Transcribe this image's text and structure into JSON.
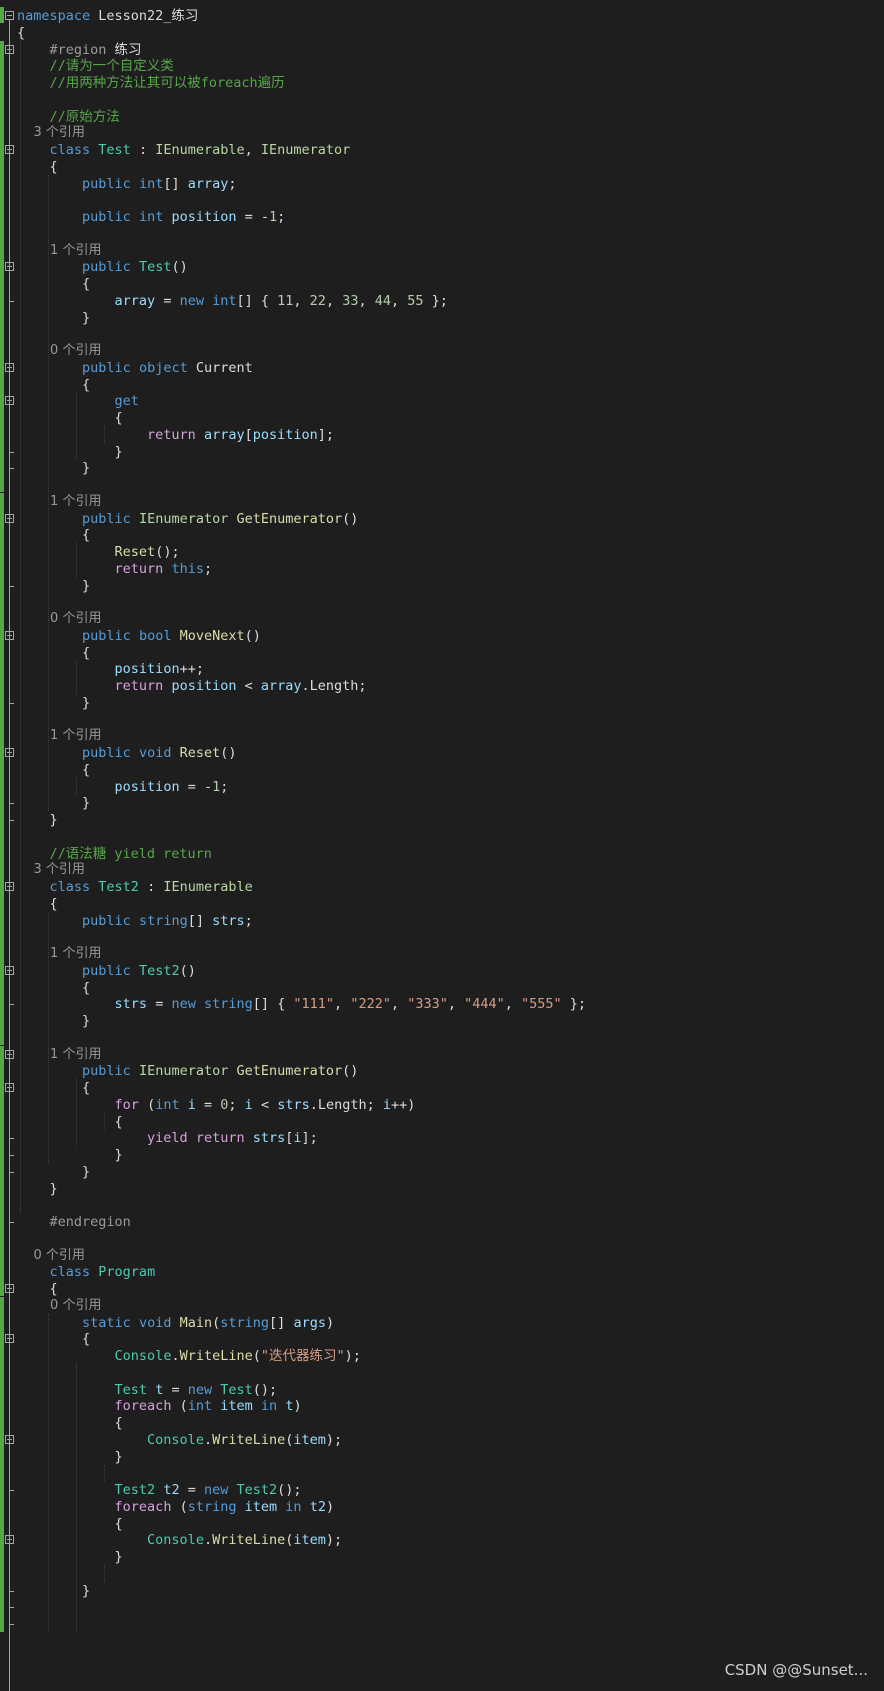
{
  "colors": {
    "background": "#1e1e1e",
    "keyword": "#569cd6",
    "control": "#d8a0df",
    "type": "#4ec9b0",
    "interface": "#b8d7a3",
    "method": "#dcdcaa",
    "string": "#d69d85",
    "number": "#b5cea8",
    "comment": "#57a64a",
    "identifier": "#9cdcfe",
    "text": "#dcdcdc",
    "preprocessor": "#9b9b9b",
    "codelens": "#999999"
  },
  "code_lines": [
    {
      "tokens": [
        [
          "namespace",
          "kw"
        ],
        [
          " Lesson22_练习",
          ""
        ]
      ]
    },
    {
      "tokens": [
        [
          "{",
          ""
        ]
      ]
    },
    {
      "tokens": [
        [
          "    ",
          ""
        ],
        [
          "#region",
          "pp"
        ],
        [
          " 练习",
          ""
        ]
      ]
    },
    {
      "tokens": [
        [
          "    //请为一个自定义类",
          "cm"
        ]
      ]
    },
    {
      "tokens": [
        [
          "    //用两种方法让其可以被foreach遍历",
          "cm"
        ]
      ]
    },
    {
      "tokens": []
    },
    {
      "tokens": [
        [
          "    //原始方法",
          "cm"
        ]
      ]
    },
    {
      "lens": "    3 个引用"
    },
    {
      "tokens": [
        [
          "    ",
          ""
        ],
        [
          "class",
          "kw"
        ],
        [
          " ",
          ""
        ],
        [
          "Test",
          "ty"
        ],
        [
          " : ",
          ""
        ],
        [
          "IEnumerable",
          "it"
        ],
        [
          ", ",
          ""
        ],
        [
          "IEnumerator",
          "it"
        ]
      ]
    },
    {
      "tokens": [
        [
          "    {",
          ""
        ]
      ]
    },
    {
      "tokens": [
        [
          "        ",
          ""
        ],
        [
          "public",
          "kw"
        ],
        [
          " ",
          ""
        ],
        [
          "int",
          "kw"
        ],
        [
          "[] ",
          ""
        ],
        [
          "array",
          "id"
        ],
        [
          ";",
          ""
        ]
      ]
    },
    {
      "tokens": []
    },
    {
      "tokens": [
        [
          "        ",
          ""
        ],
        [
          "public",
          "kw"
        ],
        [
          " ",
          ""
        ],
        [
          "int",
          "kw"
        ],
        [
          " ",
          ""
        ],
        [
          "position",
          "id"
        ],
        [
          " = -",
          ""
        ],
        [
          "1",
          "nm"
        ],
        [
          ";",
          ""
        ]
      ]
    },
    {
      "tokens": []
    },
    {
      "lens": "        1 个引用"
    },
    {
      "tokens": [
        [
          "        ",
          ""
        ],
        [
          "public",
          "kw"
        ],
        [
          " ",
          ""
        ],
        [
          "Test",
          "ty"
        ],
        [
          "()",
          ""
        ]
      ]
    },
    {
      "tokens": [
        [
          "        {",
          ""
        ]
      ]
    },
    {
      "tokens": [
        [
          "            ",
          ""
        ],
        [
          "array",
          "id"
        ],
        [
          " = ",
          ""
        ],
        [
          "new",
          "kw"
        ],
        [
          " ",
          ""
        ],
        [
          "int",
          "kw"
        ],
        [
          "[] { ",
          ""
        ],
        [
          "11",
          "nm"
        ],
        [
          ", ",
          ""
        ],
        [
          "22",
          "nm"
        ],
        [
          ", ",
          ""
        ],
        [
          "33",
          "nm"
        ],
        [
          ", ",
          ""
        ],
        [
          "44",
          "nm"
        ],
        [
          ", ",
          ""
        ],
        [
          "55",
          "nm"
        ],
        [
          " };",
          ""
        ]
      ]
    },
    {
      "tokens": [
        [
          "        }",
          ""
        ]
      ]
    },
    {
      "tokens": []
    },
    {
      "lens": "        0 个引用"
    },
    {
      "tokens": [
        [
          "        ",
          ""
        ],
        [
          "public",
          "kw"
        ],
        [
          " ",
          ""
        ],
        [
          "object",
          "kw"
        ],
        [
          " Current",
          ""
        ]
      ]
    },
    {
      "tokens": [
        [
          "        {",
          ""
        ]
      ]
    },
    {
      "tokens": [
        [
          "            ",
          ""
        ],
        [
          "get",
          "kw"
        ]
      ]
    },
    {
      "tokens": [
        [
          "            {",
          ""
        ]
      ]
    },
    {
      "tokens": [
        [
          "                ",
          ""
        ],
        [
          "return",
          "ct"
        ],
        [
          " ",
          ""
        ],
        [
          "array",
          "id"
        ],
        [
          "[",
          ""
        ],
        [
          "position",
          "id"
        ],
        [
          "];",
          ""
        ]
      ]
    },
    {
      "tokens": [
        [
          "            }",
          ""
        ]
      ]
    },
    {
      "tokens": [
        [
          "        }",
          ""
        ]
      ]
    },
    {
      "tokens": []
    },
    {
      "lens": "        1 个引用"
    },
    {
      "tokens": [
        [
          "        ",
          ""
        ],
        [
          "public",
          "kw"
        ],
        [
          " ",
          ""
        ],
        [
          "IEnumerator",
          "it"
        ],
        [
          " ",
          ""
        ],
        [
          "GetEnumerator",
          "mt"
        ],
        [
          "()",
          ""
        ]
      ]
    },
    {
      "tokens": [
        [
          "        {",
          ""
        ]
      ]
    },
    {
      "tokens": [
        [
          "            ",
          ""
        ],
        [
          "Reset",
          "mt"
        ],
        [
          "();",
          ""
        ]
      ]
    },
    {
      "tokens": [
        [
          "            ",
          ""
        ],
        [
          "return",
          "ct"
        ],
        [
          " ",
          ""
        ],
        [
          "this",
          "kw"
        ],
        [
          ";",
          ""
        ]
      ]
    },
    {
      "tokens": [
        [
          "        }",
          ""
        ]
      ]
    },
    {
      "tokens": []
    },
    {
      "lens": "        0 个引用"
    },
    {
      "tokens": [
        [
          "        ",
          ""
        ],
        [
          "public",
          "kw"
        ],
        [
          " ",
          ""
        ],
        [
          "bool",
          "kw"
        ],
        [
          " ",
          ""
        ],
        [
          "MoveNext",
          "mt"
        ],
        [
          "()",
          ""
        ]
      ]
    },
    {
      "tokens": [
        [
          "        {",
          ""
        ]
      ]
    },
    {
      "tokens": [
        [
          "            ",
          ""
        ],
        [
          "position",
          "id"
        ],
        [
          "++;",
          ""
        ]
      ]
    },
    {
      "tokens": [
        [
          "            ",
          ""
        ],
        [
          "return",
          "ct"
        ],
        [
          " ",
          ""
        ],
        [
          "position",
          "id"
        ],
        [
          " < ",
          ""
        ],
        [
          "array",
          "id"
        ],
        [
          ".Length;",
          ""
        ]
      ]
    },
    {
      "tokens": [
        [
          "        }",
          ""
        ]
      ]
    },
    {
      "tokens": []
    },
    {
      "lens": "        1 个引用"
    },
    {
      "tokens": [
        [
          "        ",
          ""
        ],
        [
          "public",
          "kw"
        ],
        [
          " ",
          ""
        ],
        [
          "void",
          "kw"
        ],
        [
          " ",
          ""
        ],
        [
          "Reset",
          "mt"
        ],
        [
          "()",
          ""
        ]
      ]
    },
    {
      "tokens": [
        [
          "        {",
          ""
        ]
      ]
    },
    {
      "tokens": [
        [
          "            ",
          ""
        ],
        [
          "position",
          "id"
        ],
        [
          " = -",
          ""
        ],
        [
          "1",
          "nm"
        ],
        [
          ";",
          ""
        ]
      ]
    },
    {
      "tokens": [
        [
          "        }",
          ""
        ]
      ]
    },
    {
      "tokens": [
        [
          "    }",
          ""
        ]
      ]
    },
    {
      "tokens": []
    },
    {
      "tokens": [
        [
          "    //语法糖 yield return",
          "cm"
        ]
      ]
    },
    {
      "lens": "    3 个引用"
    },
    {
      "tokens": [
        [
          "    ",
          ""
        ],
        [
          "class",
          "kw"
        ],
        [
          " ",
          ""
        ],
        [
          "Test2",
          "ty"
        ],
        [
          " : ",
          ""
        ],
        [
          "IEnumerable",
          "it"
        ]
      ]
    },
    {
      "tokens": [
        [
          "    {",
          ""
        ]
      ]
    },
    {
      "tokens": [
        [
          "        ",
          ""
        ],
        [
          "public",
          "kw"
        ],
        [
          " ",
          ""
        ],
        [
          "string",
          "kw"
        ],
        [
          "[] ",
          ""
        ],
        [
          "strs",
          "id"
        ],
        [
          ";",
          ""
        ]
      ]
    },
    {
      "tokens": []
    },
    {
      "lens": "        1 个引用"
    },
    {
      "tokens": [
        [
          "        ",
          ""
        ],
        [
          "public",
          "kw"
        ],
        [
          " ",
          ""
        ],
        [
          "Test2",
          "ty"
        ],
        [
          "()",
          ""
        ]
      ]
    },
    {
      "tokens": [
        [
          "        {",
          ""
        ]
      ]
    },
    {
      "tokens": [
        [
          "            ",
          ""
        ],
        [
          "strs",
          "id"
        ],
        [
          " = ",
          ""
        ],
        [
          "new",
          "kw"
        ],
        [
          " ",
          ""
        ],
        [
          "string",
          "kw"
        ],
        [
          "[] { ",
          ""
        ],
        [
          "\"111\"",
          "st"
        ],
        [
          ", ",
          ""
        ],
        [
          "\"222\"",
          "st"
        ],
        [
          ", ",
          ""
        ],
        [
          "\"333\"",
          "st"
        ],
        [
          ", ",
          ""
        ],
        [
          "\"444\"",
          "st"
        ],
        [
          ", ",
          ""
        ],
        [
          "\"555\"",
          "st"
        ],
        [
          " };",
          ""
        ]
      ]
    },
    {
      "tokens": [
        [
          "        }",
          ""
        ]
      ]
    },
    {
      "tokens": []
    },
    {
      "lens": "        1 个引用"
    },
    {
      "tokens": [
        [
          "        ",
          ""
        ],
        [
          "public",
          "kw"
        ],
        [
          " ",
          ""
        ],
        [
          "IEnumerator",
          "it"
        ],
        [
          " ",
          ""
        ],
        [
          "GetEnumerator",
          "mt"
        ],
        [
          "()",
          ""
        ]
      ]
    },
    {
      "tokens": [
        [
          "        {",
          ""
        ]
      ]
    },
    {
      "tokens": [
        [
          "            ",
          ""
        ],
        [
          "for",
          "ct"
        ],
        [
          " (",
          ""
        ],
        [
          "int",
          "kw"
        ],
        [
          " ",
          ""
        ],
        [
          "i",
          "id"
        ],
        [
          " = ",
          ""
        ],
        [
          "0",
          "nm"
        ],
        [
          "; ",
          ""
        ],
        [
          "i",
          "id"
        ],
        [
          " < ",
          ""
        ],
        [
          "strs",
          "id"
        ],
        [
          ".Length; ",
          ""
        ],
        [
          "i",
          "id"
        ],
        [
          "++)",
          ""
        ]
      ]
    },
    {
      "tokens": [
        [
          "            {",
          ""
        ]
      ]
    },
    {
      "tokens": [
        [
          "                ",
          ""
        ],
        [
          "yield",
          "ct"
        ],
        [
          " ",
          ""
        ],
        [
          "return",
          "ct"
        ],
        [
          " ",
          ""
        ],
        [
          "strs",
          "id"
        ],
        [
          "[",
          ""
        ],
        [
          "i",
          "id"
        ],
        [
          "];",
          ""
        ]
      ]
    },
    {
      "tokens": [
        [
          "            }",
          ""
        ]
      ]
    },
    {
      "tokens": [
        [
          "        }",
          ""
        ]
      ]
    },
    {
      "tokens": [
        [
          "    }",
          ""
        ]
      ]
    },
    {
      "tokens": []
    },
    {
      "tokens": [
        [
          "    ",
          ""
        ],
        [
          "#endregion",
          "pp"
        ]
      ]
    },
    {
      "tokens": []
    },
    {
      "lens": "    0 个引用"
    },
    {
      "tokens": [
        [
          "    ",
          ""
        ],
        [
          "class",
          "kw"
        ],
        [
          " ",
          ""
        ],
        [
          "Program",
          "ty"
        ]
      ]
    },
    {
      "tokens": [
        [
          "    {",
          ""
        ]
      ]
    },
    {
      "lens": "        0 个引用"
    },
    {
      "tokens": [
        [
          "        ",
          ""
        ],
        [
          "static",
          "kw"
        ],
        [
          " ",
          ""
        ],
        [
          "void",
          "kw"
        ],
        [
          " ",
          ""
        ],
        [
          "Main",
          "mt"
        ],
        [
          "(",
          ""
        ],
        [
          "string",
          "kw"
        ],
        [
          "[] ",
          ""
        ],
        [
          "args",
          "id"
        ],
        [
          ")",
          ""
        ]
      ]
    },
    {
      "tokens": [
        [
          "        {",
          ""
        ]
      ]
    },
    {
      "tokens": [
        [
          "            ",
          ""
        ],
        [
          "Console",
          "ty"
        ],
        [
          ".",
          ""
        ],
        [
          "WriteLine",
          "mt"
        ],
        [
          "(",
          ""
        ],
        [
          "\"迭代器练习\"",
          "st"
        ],
        [
          ");",
          ""
        ]
      ]
    },
    {
      "tokens": []
    },
    {
      "tokens": [
        [
          "            ",
          ""
        ],
        [
          "Test",
          "ty"
        ],
        [
          " ",
          ""
        ],
        [
          "t",
          "id"
        ],
        [
          " = ",
          ""
        ],
        [
          "new",
          "kw"
        ],
        [
          " ",
          ""
        ],
        [
          "Test",
          "ty"
        ],
        [
          "();",
          ""
        ]
      ]
    },
    {
      "tokens": [
        [
          "            ",
          ""
        ],
        [
          "foreach",
          "ct"
        ],
        [
          " (",
          ""
        ],
        [
          "int",
          "kw"
        ],
        [
          " ",
          ""
        ],
        [
          "item",
          "id"
        ],
        [
          " ",
          ""
        ],
        [
          "in",
          "kw"
        ],
        [
          " ",
          ""
        ],
        [
          "t",
          "id"
        ],
        [
          ")",
          ""
        ]
      ]
    },
    {
      "tokens": [
        [
          "            {",
          ""
        ]
      ]
    },
    {
      "tokens": [
        [
          "                ",
          ""
        ],
        [
          "Console",
          "ty"
        ],
        [
          ".",
          ""
        ],
        [
          "WriteLine",
          "mt"
        ],
        [
          "(",
          ""
        ],
        [
          "item",
          "id"
        ],
        [
          ");",
          ""
        ]
      ]
    },
    {
      "tokens": [
        [
          "            }",
          ""
        ]
      ]
    },
    {
      "tokens": []
    },
    {
      "tokens": [
        [
          "            ",
          ""
        ],
        [
          "Test2",
          "ty"
        ],
        [
          " ",
          ""
        ],
        [
          "t2",
          "id"
        ],
        [
          " = ",
          ""
        ],
        [
          "new",
          "kw"
        ],
        [
          " ",
          ""
        ],
        [
          "Test2",
          "ty"
        ],
        [
          "();",
          ""
        ]
      ]
    },
    {
      "tokens": [
        [
          "            ",
          ""
        ],
        [
          "foreach",
          "ct"
        ],
        [
          " (",
          ""
        ],
        [
          "string",
          "kw"
        ],
        [
          " ",
          ""
        ],
        [
          "item",
          "id"
        ],
        [
          " ",
          ""
        ],
        [
          "in",
          "kw"
        ],
        [
          " ",
          ""
        ],
        [
          "t2",
          "id"
        ],
        [
          ")",
          ""
        ]
      ]
    },
    {
      "tokens": [
        [
          "            {",
          ""
        ]
      ]
    },
    {
      "tokens": [
        [
          "                ",
          ""
        ],
        [
          "Console",
          "ty"
        ],
        [
          ".",
          ""
        ],
        [
          "WriteLine",
          "mt"
        ],
        [
          "(",
          ""
        ],
        [
          "item",
          "id"
        ],
        [
          ");",
          ""
        ]
      ]
    },
    {
      "tokens": [
        [
          "            }",
          ""
        ]
      ]
    },
    {
      "tokens": []
    },
    {
      "tokens": [
        [
          "        }",
          ""
        ]
      ]
    }
  ],
  "watermark": "CSDN @@Sunset..."
}
